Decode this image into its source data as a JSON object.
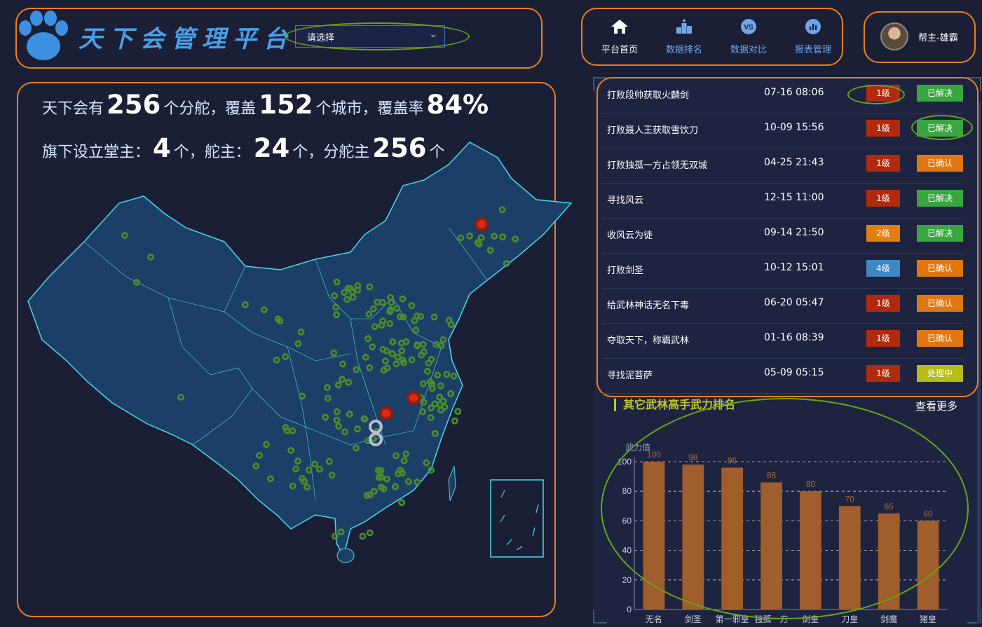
{
  "header": {
    "title": "天下会管理平台",
    "select_value": "请选择"
  },
  "nav": [
    {
      "label": "平台首页",
      "icon": "home-icon"
    },
    {
      "label": "数据排名",
      "icon": "podium-icon"
    },
    {
      "label": "数据对比",
      "icon": "vs-icon"
    },
    {
      "label": "报表管理",
      "icon": "report-chart-icon"
    }
  ],
  "user": {
    "name": "帮主-雄霸"
  },
  "stats": {
    "line1_a": "天下会有",
    "branches": "256",
    "line1_b": "个分舵，覆盖",
    "cities": "152",
    "line1_c": "个城市，覆盖率",
    "coverage": "84%",
    "line2_a": "旗下设立堂主：",
    "hall_masters": "4",
    "line2_b": "个，舵主：",
    "rudder_masters": "24",
    "line2_c": "个，分舵主",
    "branch_masters": "256",
    "line2_d": "个"
  },
  "events": [
    {
      "title": "打败段帅获取火麟剑",
      "time": "07-16 08:06",
      "level": "1级",
      "status": "已解决"
    },
    {
      "title": "打败聂人王获取雪饮刀",
      "time": "10-09 15:56",
      "level": "1级",
      "status": "已解决"
    },
    {
      "title": "打败独孤一方占领无双城",
      "time": "04-25 21:43",
      "level": "1级",
      "status": "已确认"
    },
    {
      "title": "寻找风云",
      "time": "12-15 11:00",
      "level": "1级",
      "status": "已解决"
    },
    {
      "title": "收风云为徒",
      "time": "09-14 21:50",
      "level": "2级",
      "status": "已解决"
    },
    {
      "title": "打败剑圣",
      "time": "10-12 15:01",
      "level": "4级",
      "status": "已确认"
    },
    {
      "title": "给武林神话无名下毒",
      "time": "06-20 05:47",
      "level": "1级",
      "status": "已确认"
    },
    {
      "title": "夺取天下，称霸武林",
      "time": "01-16 08:39",
      "level": "1级",
      "status": "已确认"
    },
    {
      "title": "寻找泥菩萨",
      "time": "05-09 05:15",
      "level": "1级",
      "status": "处理中"
    }
  ],
  "colors": {
    "level_1": "#b22a0e",
    "level_2": "#e2800f",
    "level_4": "#3e88c4",
    "status_resolved": "#3aa641",
    "status_confirmed": "#e07711",
    "status_processing": "#b6bd1b",
    "accent_orange": "#e8801f",
    "bar": "#a05e2c"
  },
  "ranking": {
    "title": "其它武林高手武力排名",
    "more": "查看更多"
  },
  "chart_data": {
    "type": "bar",
    "ylabel": "武力值",
    "ylim": [
      0,
      100
    ],
    "yticks": [
      0,
      20,
      40,
      60,
      80,
      100
    ],
    "categories": [
      "无名",
      "剑圣",
      "第一邪皇",
      "独孤一方",
      "剑皇",
      "刀皇",
      "剑魔",
      "猪皇"
    ],
    "values": [
      100,
      98,
      96,
      86,
      80,
      70,
      65,
      60
    ],
    "grid": true
  }
}
